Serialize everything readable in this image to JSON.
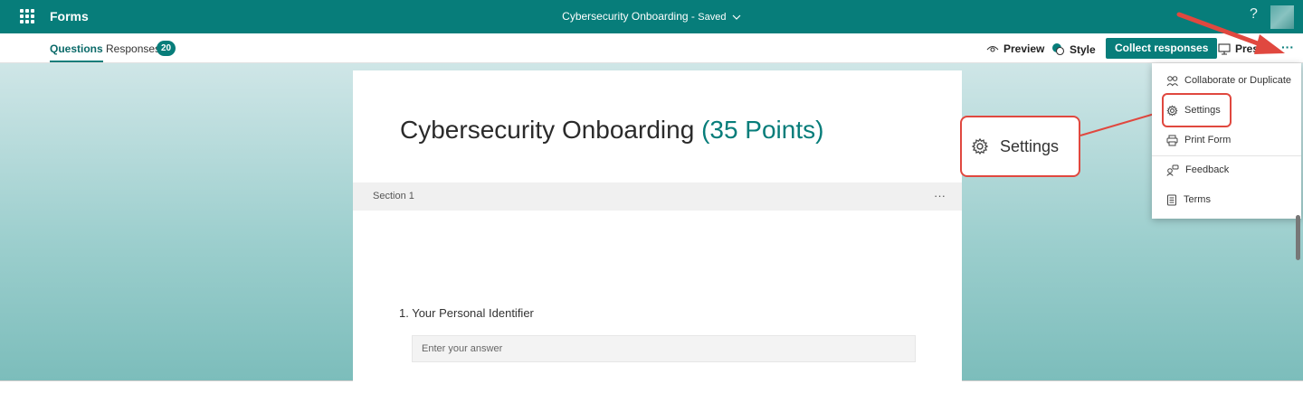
{
  "header": {
    "app_name": "Forms",
    "doc_title": "Cybersecurity Onboarding",
    "separator": "-",
    "saved_label": "Saved",
    "help_label": "?"
  },
  "tabs": {
    "questions": "Questions",
    "responses": "Responses",
    "responses_count": "20"
  },
  "toolbar": {
    "preview": "Preview",
    "style": "Style",
    "collect": "Collect responses",
    "present": "Pres",
    "more": "···"
  },
  "form": {
    "title": "Cybersecurity Onboarding",
    "points": "(35 Points)",
    "section_label": "Section 1",
    "section_more": "···",
    "question_label": "1. Your Personal Identifier",
    "answer_placeholder": "Enter your answer"
  },
  "menu": {
    "items": [
      {
        "label": "Collaborate or Duplicate",
        "icon": "collaborate-icon"
      },
      {
        "label": "Settings",
        "icon": "gear-icon"
      },
      {
        "label": "Print Form",
        "icon": "printer-icon"
      },
      {
        "label": "Feedback",
        "icon": "feedback-icon"
      },
      {
        "label": "Terms",
        "icon": "document-icon"
      }
    ]
  },
  "callout": {
    "label": "Settings",
    "icon": "gear-icon"
  },
  "colors": {
    "brand": "#077d7a",
    "annotation": "#e0483f"
  }
}
